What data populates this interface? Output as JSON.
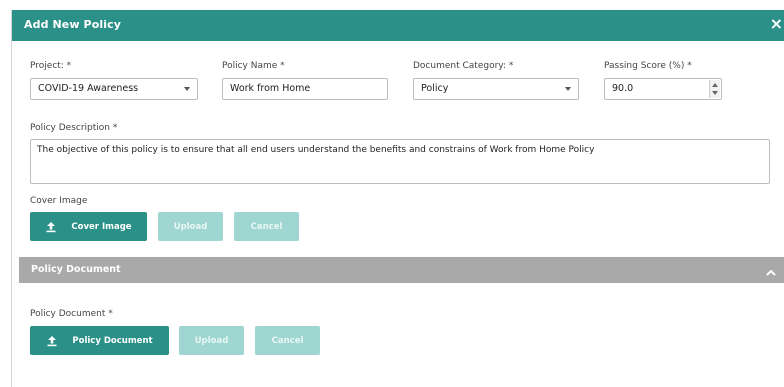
{
  "dialog": {
    "title": "Add New Policy",
    "close_glyph": "×"
  },
  "form": {
    "project": {
      "label": "Project: *",
      "value": "COVID-19 Awareness"
    },
    "policy_name": {
      "label": "Policy Name *",
      "value": "Work from Home"
    },
    "document_category": {
      "label": "Document Category: *",
      "value": "Policy"
    },
    "passing_score": {
      "label": "Passing Score (%) *",
      "value": "90.0"
    },
    "policy_description": {
      "label": "Policy Description *",
      "value": "The objective of this policy is to ensure that all end users understand the benefits and constrains of Work from Home Policy"
    }
  },
  "cover_image": {
    "label": "Cover Image",
    "choose_label": "Cover Image",
    "upload_label": "Upload",
    "cancel_label": "Cancel"
  },
  "policy_document_section": {
    "title": "Policy Document",
    "label": "Policy Document *",
    "choose_label": "Policy Document",
    "upload_label": "Upload",
    "cancel_label": "Cancel"
  },
  "colors": {
    "primary": "#2a9088",
    "primary_disabled": "#9fd6d1",
    "section_header": "#a9a9a9"
  },
  "icons": {
    "close": "close-icon",
    "upload": "upload-icon",
    "collapse": "chevron-up-icon",
    "select_caret": "chevron-down-icon"
  }
}
